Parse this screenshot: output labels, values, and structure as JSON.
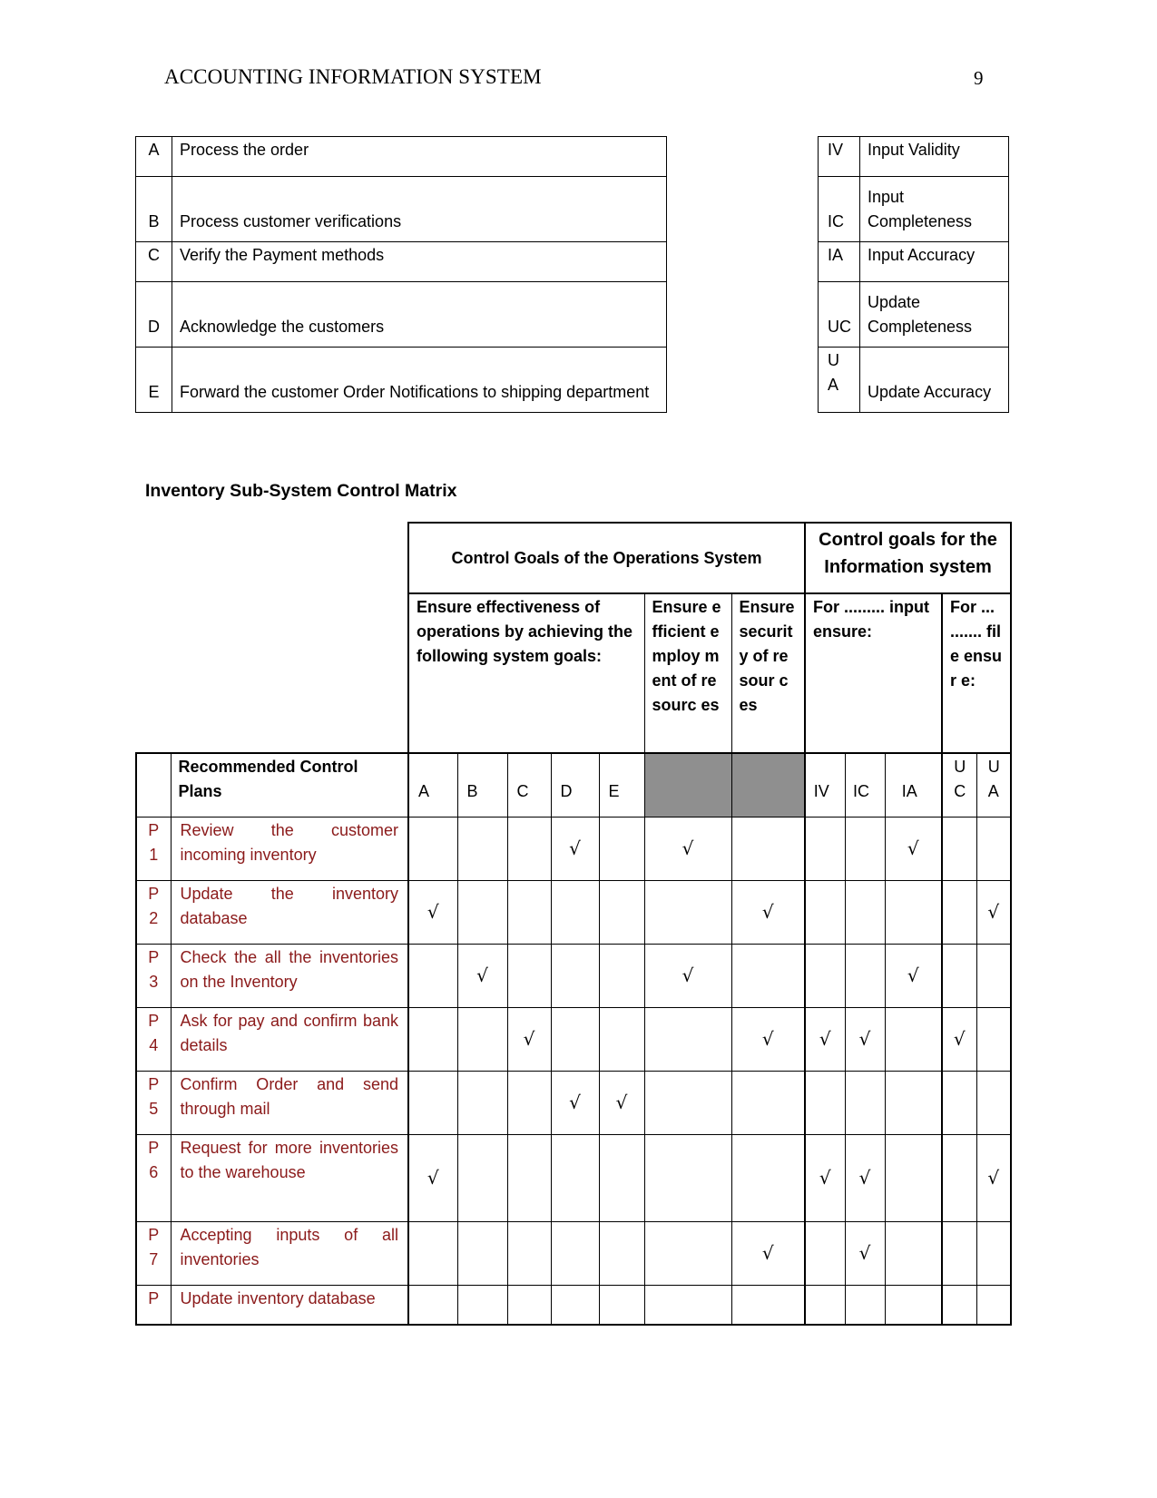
{
  "header": {
    "running_head": "ACCOUNTING INFORMATION SYSTEM",
    "page_number": "9"
  },
  "legend_operations": [
    {
      "code": "A",
      "text": "Process the order"
    },
    {
      "code": "B",
      "text": "Process customer verifications"
    },
    {
      "code": "C",
      "text": "Verify the Payment methods"
    },
    {
      "code": "D",
      "text": "Acknowledge the customers"
    },
    {
      "code": "E",
      "text": "Forward the customer Order Notifications to shipping department"
    }
  ],
  "legend_information": [
    {
      "code": "IV",
      "text": "Input Validity"
    },
    {
      "code": "IC",
      "text": "Input Completeness"
    },
    {
      "code": "IA",
      "text": "Input Accuracy"
    },
    {
      "code": "UC",
      "text": "Update Completeness"
    },
    {
      "code": "UA",
      "text": "Update Accuracy"
    }
  ],
  "matrix": {
    "title": "Inventory Sub-System Control Matrix",
    "group_operations": "Control Goals of the Operations System",
    "group_information": "Control goals for the Information system",
    "sub_effectiveness": "Ensure effectiveness of operations by achieving the following system goals:",
    "sub_efficient": "Ensure efficient employ ment of resourc es",
    "sub_security": "Ensure securit y of resour ces",
    "sub_input": "For ......... input ensure:",
    "sub_file": "For ... ....... file ensur e:",
    "plans_header": "Recommended Control Plans",
    "columns": [
      "A",
      "B",
      "C",
      "D",
      "E",
      "EFF",
      "SEC",
      "IV",
      "IC",
      "IA",
      "UC",
      "UA"
    ],
    "column_labels": {
      "A": "A",
      "B": "B",
      "C": "C",
      "D": "D",
      "E": "E",
      "IV": "IV",
      "IC": "IC",
      "IA": "IA",
      "UC": "UC",
      "UA": "UA"
    },
    "check_symbol": "√",
    "rows": [
      {
        "id": "P1",
        "num": "1",
        "prefix": "P",
        "plan": "Review the customer incoming inventory",
        "checks": [
          "D",
          "EFF",
          "IA"
        ]
      },
      {
        "id": "P2",
        "num": "2",
        "prefix": "P",
        "plan": "Update the inventory database",
        "checks": [
          "A",
          "SEC",
          "UA"
        ]
      },
      {
        "id": "P3",
        "num": "3",
        "prefix": "P",
        "plan": "Check the all the inventories on the Inventory",
        "checks": [
          "B",
          "EFF",
          "IA"
        ]
      },
      {
        "id": "P4",
        "num": "4",
        "prefix": "P",
        "plan": "Ask for pay and confirm bank details",
        "checks": [
          "C",
          "SEC",
          "IV",
          "IC",
          "UC"
        ]
      },
      {
        "id": "P5",
        "num": "5",
        "prefix": "P",
        "plan": "Confirm Order and send through mail",
        "checks": [
          "D",
          "E"
        ]
      },
      {
        "id": "P6",
        "num": "6",
        "prefix": "P",
        "plan": "Request for more inventories to the warehouse",
        "checks": [
          "A",
          "IV",
          "IC",
          "UA"
        ]
      },
      {
        "id": "P7",
        "num": "7",
        "prefix": "P",
        "plan": "Accepting inputs of all inventories",
        "checks": [
          "SEC",
          "IC"
        ]
      },
      {
        "id": "P8",
        "num": "",
        "prefix": "P",
        "plan": "Update inventory  database",
        "checks": []
      }
    ]
  }
}
